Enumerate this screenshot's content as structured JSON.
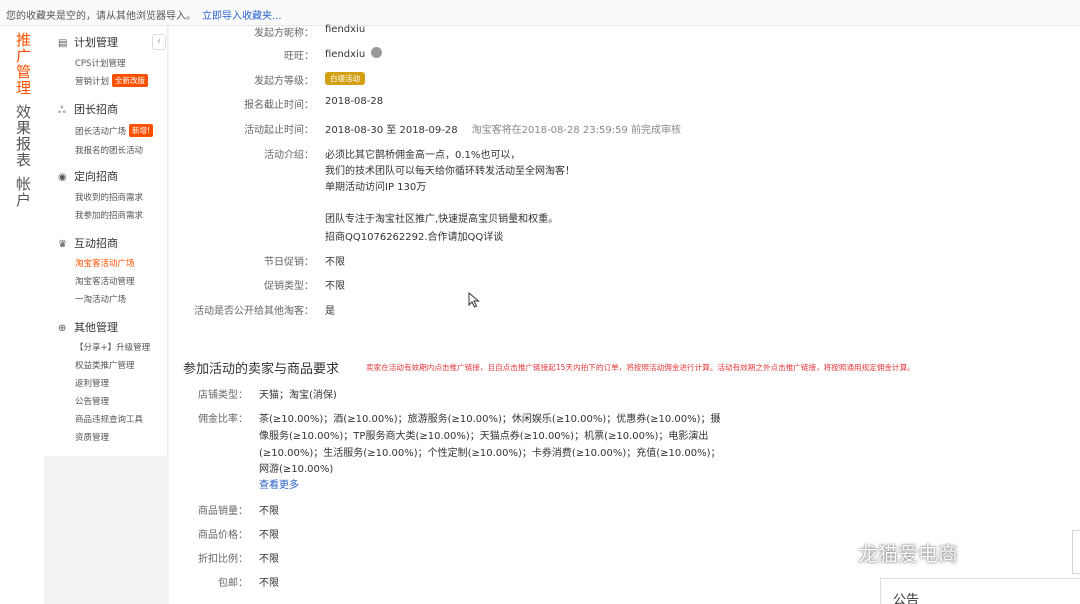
{
  "bookmark_bar": {
    "message": "您的收藏夹是空的，请从其他浏览器导入。",
    "import_link": "立即导入收藏夹..."
  },
  "left_nav": [
    {
      "label": "推广管理",
      "active": true
    },
    {
      "label": "效果报表",
      "active": false
    },
    {
      "label": "帐户",
      "active": false
    }
  ],
  "sub_nav": {
    "collapse": "‹",
    "groups": [
      {
        "title": "计划管理",
        "icon": "clipboard-icon",
        "items": [
          {
            "label": "CPS计划管理"
          },
          {
            "label": "营销计划",
            "badge": "全新改版"
          }
        ]
      },
      {
        "title": "团长招商",
        "icon": "group-icon",
        "items": [
          {
            "label": "团长活动广场",
            "badge": "新增!"
          },
          {
            "label": "我报名的团长活动"
          }
        ]
      },
      {
        "title": "定向招商",
        "icon": "location-icon",
        "items": [
          {
            "label": "我收到的招商需求"
          },
          {
            "label": "我参加的招商需求"
          }
        ]
      },
      {
        "title": "互动招商",
        "icon": "trophy-icon",
        "items": [
          {
            "label": "淘宝客活动广场",
            "active": true
          },
          {
            "label": "淘宝客活动管理"
          },
          {
            "label": "一淘活动广场"
          }
        ]
      },
      {
        "title": "其他管理",
        "icon": "plus-circle-icon",
        "items": [
          {
            "label": "【分享+】升级管理"
          },
          {
            "label": "权益类推广管理"
          },
          {
            "label": "返利管理"
          },
          {
            "label": "公告管理"
          },
          {
            "label": "商品违规查询工具"
          },
          {
            "label": "资质管理"
          }
        ]
      }
    ]
  },
  "detail": {
    "nickname_label": "发起方昵称：",
    "nickname": "fiendxiu",
    "wangwang_label": "旺旺：",
    "wangwang": "fiendxiu",
    "level_label": "发起方等级：",
    "level": "白银活动",
    "signup_deadline_label": "报名截止时间：",
    "signup_deadline": "2018-08-28",
    "period_label": "活动起止时间：",
    "period": "2018-08-30 至 2018-09-28",
    "review_note": "淘宝客将在2018-08-28 23:59:59 前完成审核",
    "intro_label": "活动介绍：",
    "intro_lines": [
      "必须比其它鹊桥佣金高一点，0.1%也可以，",
      "我们的技术团队可以每天给你循环转发活动至全网淘客！",
      "单期活动访问IP 130万",
      "",
      "团队专注于淘宝社区推广,快速提高宝贝销量和权重。",
      "招商QQ1076262292.合作请加QQ详谈"
    ],
    "holiday_label": "节日促销：",
    "holiday": "不限",
    "promo_type_label": "促销类型：",
    "promo_type": "不限",
    "public_label": "活动是否公开给其他淘客：",
    "public": "是"
  },
  "requirements": {
    "title": "参加活动的卖家与商品要求",
    "note": "卖家在活动有效期内点击推广链接，且自点击推广链接起15天内拍下的订单，将按照活动佣金进行计算。活动有效期之外点击推广链接，将按照通用规定佣金计算。",
    "shop_type_label": "店铺类型：",
    "shop_type": "天猫；淘宝(消保)",
    "commission_label": "佣金比率：",
    "commission_lines": [
      "茶(≥10.00%)；酒(≥10.00%)；旅游服务(≥10.00%)；休闲娱乐(≥10.00%)；优惠券(≥10.00%)；摄",
      "像服务(≥10.00%)；TP服务商大类(≥10.00%)；天猫点券(≥10.00%)；机票(≥10.00%)；电影演出",
      "(≥10.00%)；生活服务(≥10.00%)；个性定制(≥10.00%)；卡券消费(≥10.00%)；充值(≥10.00%)；",
      "网游(≥10.00%)"
    ],
    "more_link": "查看更多",
    "sales_label": "商品销量：",
    "sales": "不限",
    "price_label": "商品价格：",
    "price": "不限",
    "discount_label": "折扣比例：",
    "discount": "不限",
    "shipping_label": "包邮：",
    "shipping": "不限"
  },
  "watermark": "龙猫爱电商",
  "notice": "公告",
  "colors": {
    "accent": "#ff5000",
    "alert": "#e4393c",
    "link": "#2a62c9",
    "level_badge": "#d4a013"
  }
}
